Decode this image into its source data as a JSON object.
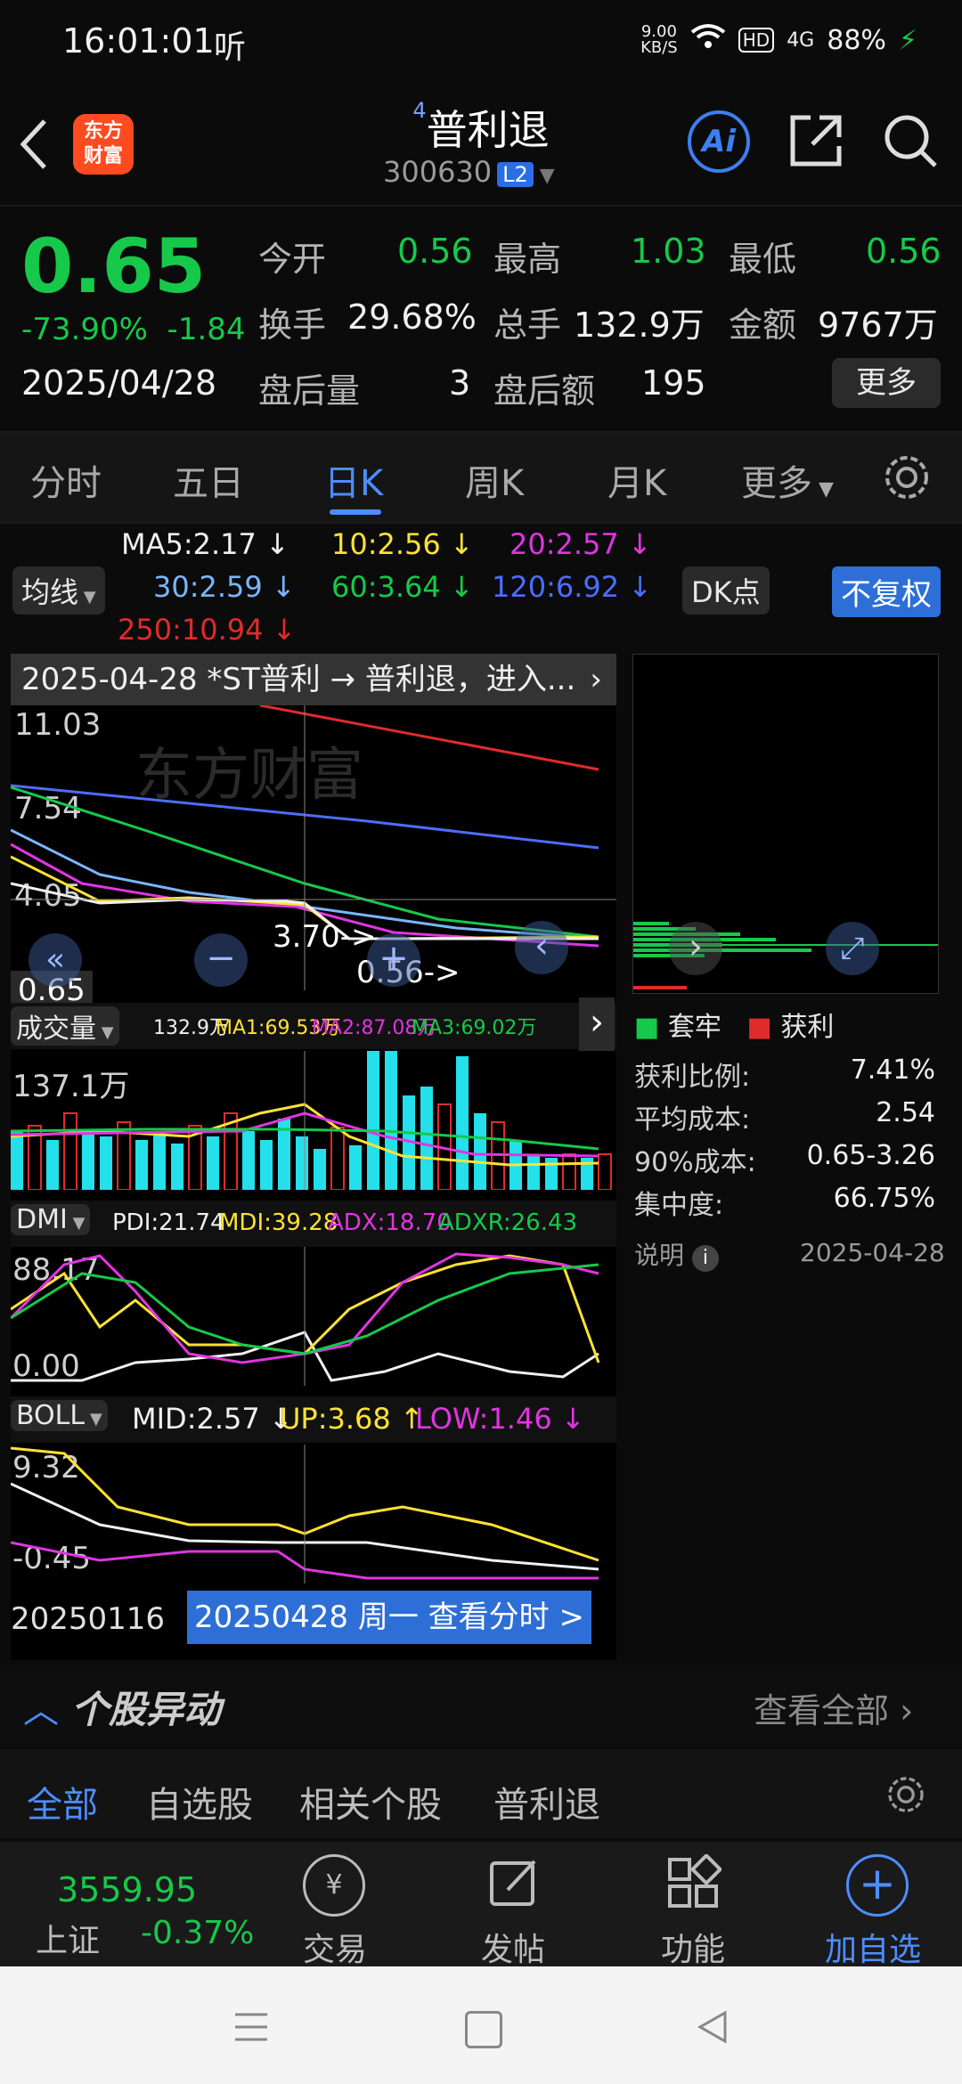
{
  "status_bar": {
    "time": "16:01:01",
    "listen": "听",
    "speed": "9.00\nKB/S",
    "hd": "HD",
    "signal": "4G",
    "battery": "88%"
  },
  "header": {
    "logo": "东方\n财富",
    "title_sup": "4",
    "title": "普利退",
    "code": "300630",
    "level": "L2",
    "ai": "Ai"
  },
  "quote": {
    "price": "0.65",
    "change_pct": "-73.90%",
    "change": "-1.84",
    "date": "2025/04/28",
    "open_label": "今开",
    "open": "0.56",
    "high_label": "最高",
    "high": "1.03",
    "low_label": "最低",
    "low": "0.56",
    "turnover_label": "换手",
    "turnover": "29.68%",
    "volume_label": "总手",
    "volume": "132.9万",
    "amount_label": "金额",
    "amount": "9767万",
    "after_vol_label": "盘后量",
    "after_vol": "3",
    "after_amt_label": "盘后额",
    "after_amt": "195",
    "more": "更多"
  },
  "tabs": {
    "t1": "分时",
    "t2": "五日",
    "t3": "日K",
    "t4": "周K",
    "t5": "月K",
    "t6": "更多"
  },
  "ma": {
    "ma5": "MA5:2.17",
    "ma10": "10:2.56",
    "ma20": "20:2.57",
    "ma30": "30:2.59",
    "ma60": "60:3.64",
    "ma120": "120:6.92",
    "ma250": "250:10.94",
    "junxian": "均线",
    "dk": "DK点",
    "fuquan": "不复权"
  },
  "kchart": {
    "news": "2025-04-28 *ST普利 → 普利退，进入...",
    "y_top": "11.03",
    "y_2": "7.54",
    "y_3": "4.05",
    "last": "0.65",
    "label_high": "3.70->",
    "label_low": "0.56->"
  },
  "volume": {
    "label": "成交量",
    "v": "132.9万",
    "ma1": "MA1:69.53万",
    "ma2": "MA2:87.08万",
    "ma3": "MA3:69.02万",
    "y_top": "137.1万"
  },
  "dmi": {
    "label": "DMI",
    "pdi": "PDI:21.74",
    "mdi": "MDI:39.28",
    "adx": "ADX:18.70",
    "adxr": "ADXR:26.43",
    "y_top": "88.17",
    "y_bot": "0.00"
  },
  "boll": {
    "label": "BOLL",
    "mid": "MID:2.57",
    "up": "UP:3.68",
    "low": "LOW:1.46",
    "y_top": "9.32",
    "y_bot": "-0.45"
  },
  "xaxis": {
    "start": "20250116",
    "cursor": "20250428 周一 查看分时 >"
  },
  "chip": {
    "trap": "套牢",
    "profit": "获利",
    "rows": [
      {
        "k": "获利比例:",
        "v": "7.41%"
      },
      {
        "k": "平均成本:",
        "v": "2.54"
      },
      {
        "k": "90%成本:",
        "v": "0.65-3.26"
      },
      {
        "k": "集中度:",
        "v": "66.75%"
      }
    ],
    "note": "说明",
    "note_date": "2025-04-28"
  },
  "movement": {
    "title": "个股异动",
    "view_all": "查看全部"
  },
  "filter_tabs": {
    "f1": "全部",
    "f2": "自选股",
    "f3": "相关个股",
    "f4": "普利退"
  },
  "bottom": {
    "index_value": "3559.95",
    "index_name": "上证",
    "index_pct": "-0.37%",
    "trade": "交易",
    "post": "发帖",
    "func": "功能",
    "add": "加自选"
  },
  "colors": {
    "green": "#16c94a",
    "red": "#e02b2b",
    "blue": "#4d8dff",
    "yellow": "#ffe234",
    "magenta": "#e035e0",
    "cyan": "#23e0ea"
  }
}
